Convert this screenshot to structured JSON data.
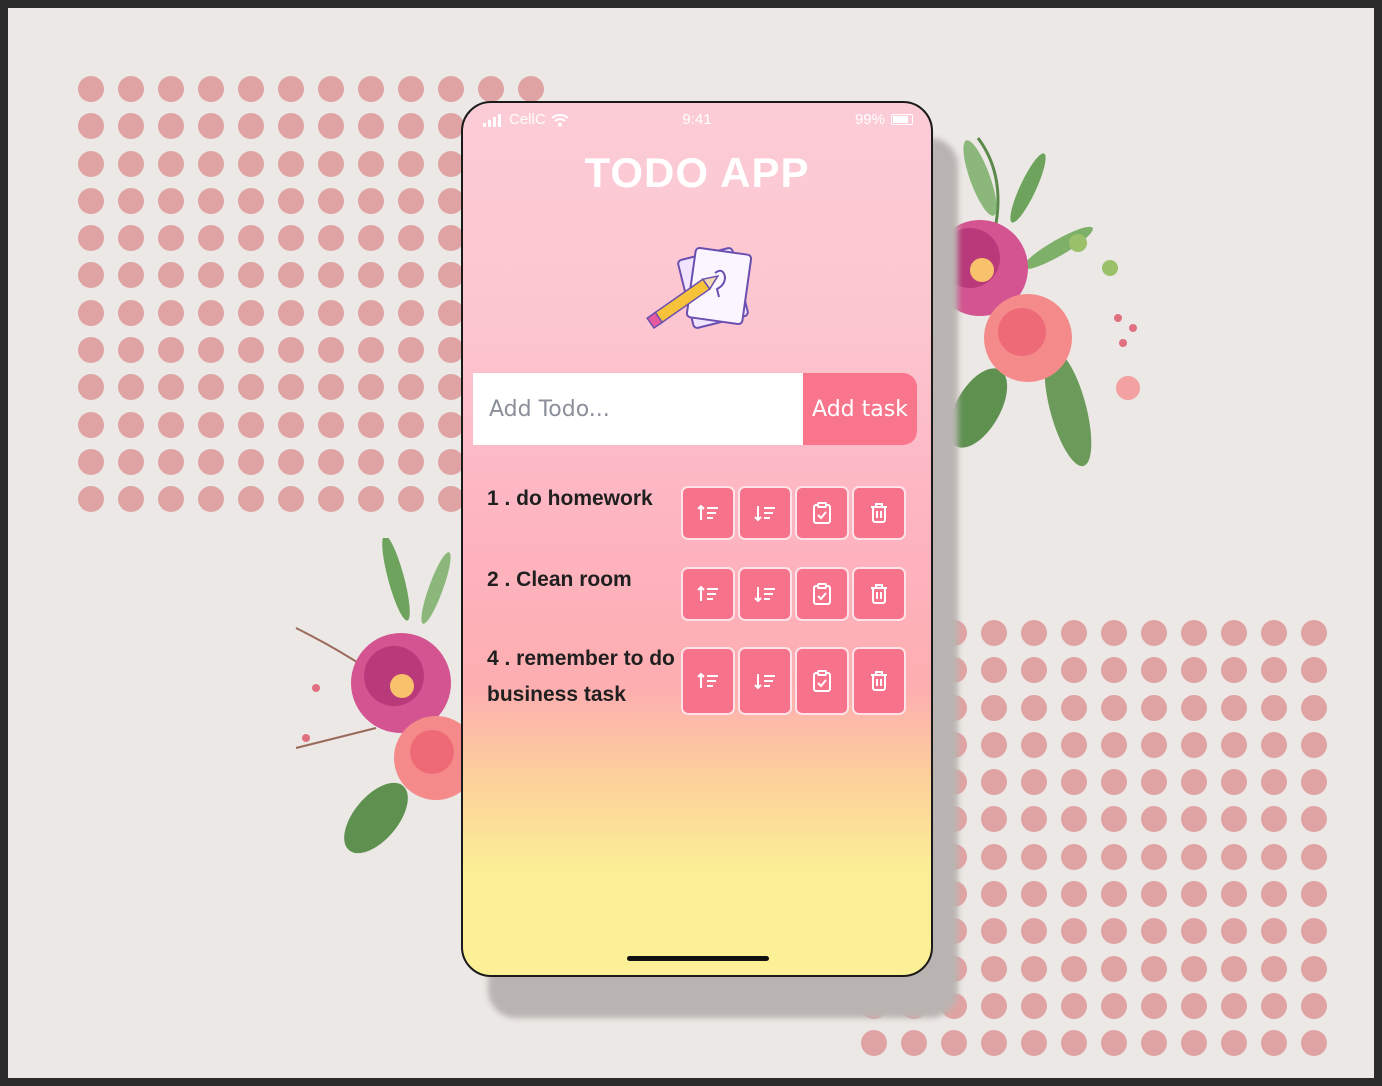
{
  "status_bar": {
    "carrier": "CellC",
    "time": "9:41",
    "battery": "99%"
  },
  "app": {
    "title": "TODO APP"
  },
  "add_form": {
    "placeholder": "Add Todo...",
    "button_label": "Add task"
  },
  "todos": [
    {
      "label": "1 . do homework"
    },
    {
      "label": "2 . Clean room"
    },
    {
      "label": "4 . remember to do business task"
    }
  ],
  "action_icons": [
    "sort-ascending-icon",
    "sort-descending-icon",
    "clipboard-check-icon",
    "trash-icon"
  ],
  "colors": {
    "accent": "#f9758c",
    "title": "#ffffff",
    "dots": "#e0a3a3",
    "background": "#ece8e5"
  }
}
